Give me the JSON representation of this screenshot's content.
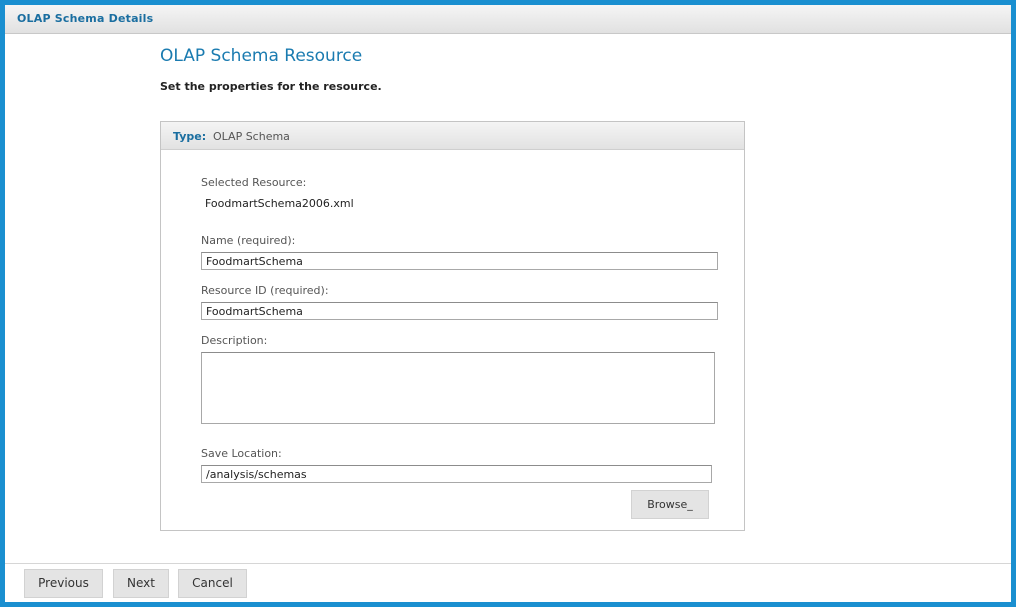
{
  "window": {
    "title": "OLAP Schema Details"
  },
  "page": {
    "heading": "OLAP Schema Resource",
    "subheading": "Set the properties for the resource."
  },
  "panel": {
    "type_label": "Type:",
    "type_value": "OLAP Schema",
    "selected_resource_label": "Selected Resource:",
    "selected_resource_value": "FoodmartSchema2006.xml",
    "name_label": "Name (required):",
    "name_value": "FoodmartSchema",
    "resource_id_label": "Resource ID (required):",
    "resource_id_value": "FoodmartSchema",
    "description_label": "Description:",
    "description_value": "",
    "save_location_label": "Save Location:",
    "save_location_value": "/analysis/schemas",
    "browse_label": "Browse_"
  },
  "footer": {
    "previous_label": "Previous",
    "next_label": "Next",
    "cancel_label": "Cancel"
  },
  "colors": {
    "frame_border": "#1a8fd0",
    "accent_text": "#1a7bb0"
  }
}
